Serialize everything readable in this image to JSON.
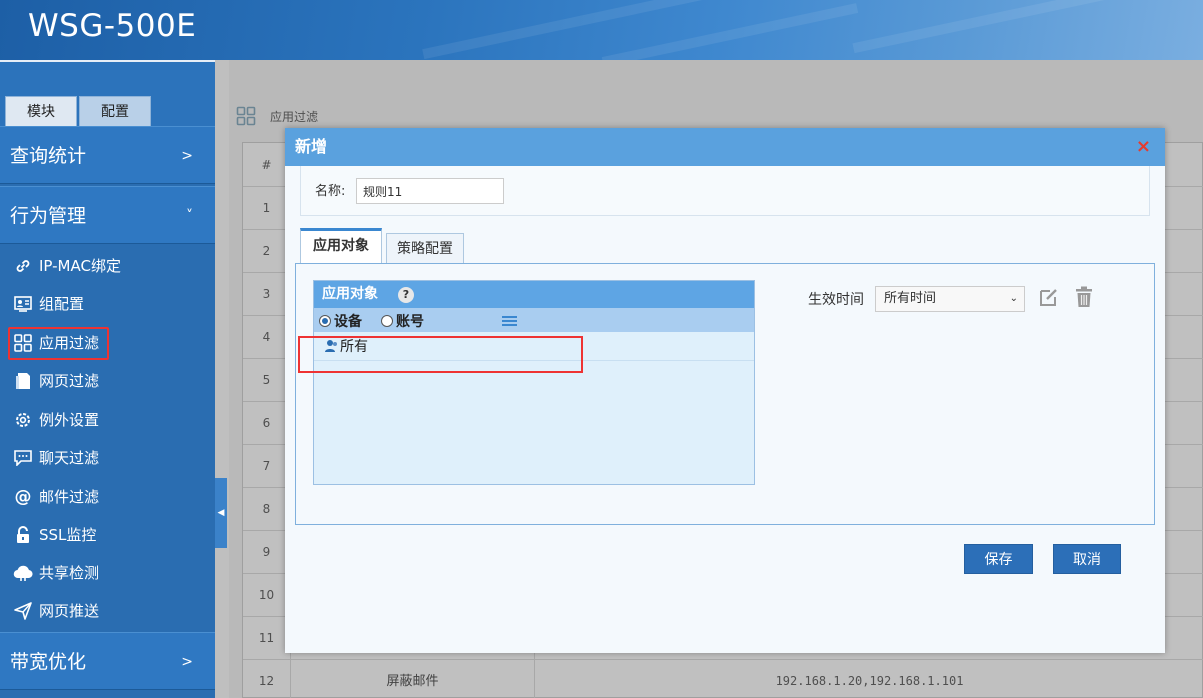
{
  "app": {
    "title": "WSG-500E"
  },
  "sidebar": {
    "tabs": [
      {
        "label": "模块"
      },
      {
        "label": "配置"
      }
    ],
    "groups": [
      {
        "label": "查询统计",
        "chevron": ">"
      },
      {
        "label": "行为管理",
        "chevron": "˅"
      },
      {
        "label": "带宽优化",
        "chevron": ">"
      }
    ],
    "items": [
      {
        "label": "IP-MAC绑定",
        "icon": "link-icon"
      },
      {
        "label": "组配置",
        "icon": "group-card-icon"
      },
      {
        "label": "应用过滤",
        "icon": "grid-icon"
      },
      {
        "label": "网页过滤",
        "icon": "webpage-icon"
      },
      {
        "label": "例外设置",
        "icon": "gear-icon"
      },
      {
        "label": "聊天过滤",
        "icon": "chat-icon"
      },
      {
        "label": "邮件过滤",
        "icon": "at-icon"
      },
      {
        "label": "SSL监控",
        "icon": "lock-icon"
      },
      {
        "label": "共享检测",
        "icon": "share-icon"
      },
      {
        "label": "网页推送",
        "icon": "send-icon"
      }
    ],
    "active_item": "应用过滤"
  },
  "main": {
    "breadcrumb": "应用过滤",
    "table": {
      "header_num": "#",
      "rows": [
        {
          "num": "1"
        },
        {
          "num": "2"
        },
        {
          "num": "3"
        },
        {
          "num": "4"
        },
        {
          "num": "5"
        },
        {
          "num": "6"
        },
        {
          "num": "7"
        },
        {
          "num": "8"
        },
        {
          "num": "9"
        },
        {
          "num": "10"
        },
        {
          "num": "11"
        },
        {
          "num": "12",
          "name": "屏蔽邮件",
          "ip": "192.168.1.20,192.168.1.101"
        }
      ]
    }
  },
  "modal": {
    "title": "新增",
    "close": "×",
    "name_label": "名称:",
    "name_value": "规则11",
    "tabs": [
      {
        "label": "应用对象"
      },
      {
        "label": "策略配置"
      }
    ],
    "object_panel": {
      "title": "应用对象",
      "help": "?",
      "radio_device": "设备",
      "radio_account": "账号",
      "rows": [
        {
          "label": "所有"
        }
      ]
    },
    "effect_label": "生效时间",
    "effect_value": "所有时间",
    "save_label": "保存",
    "cancel_label": "取消"
  }
}
